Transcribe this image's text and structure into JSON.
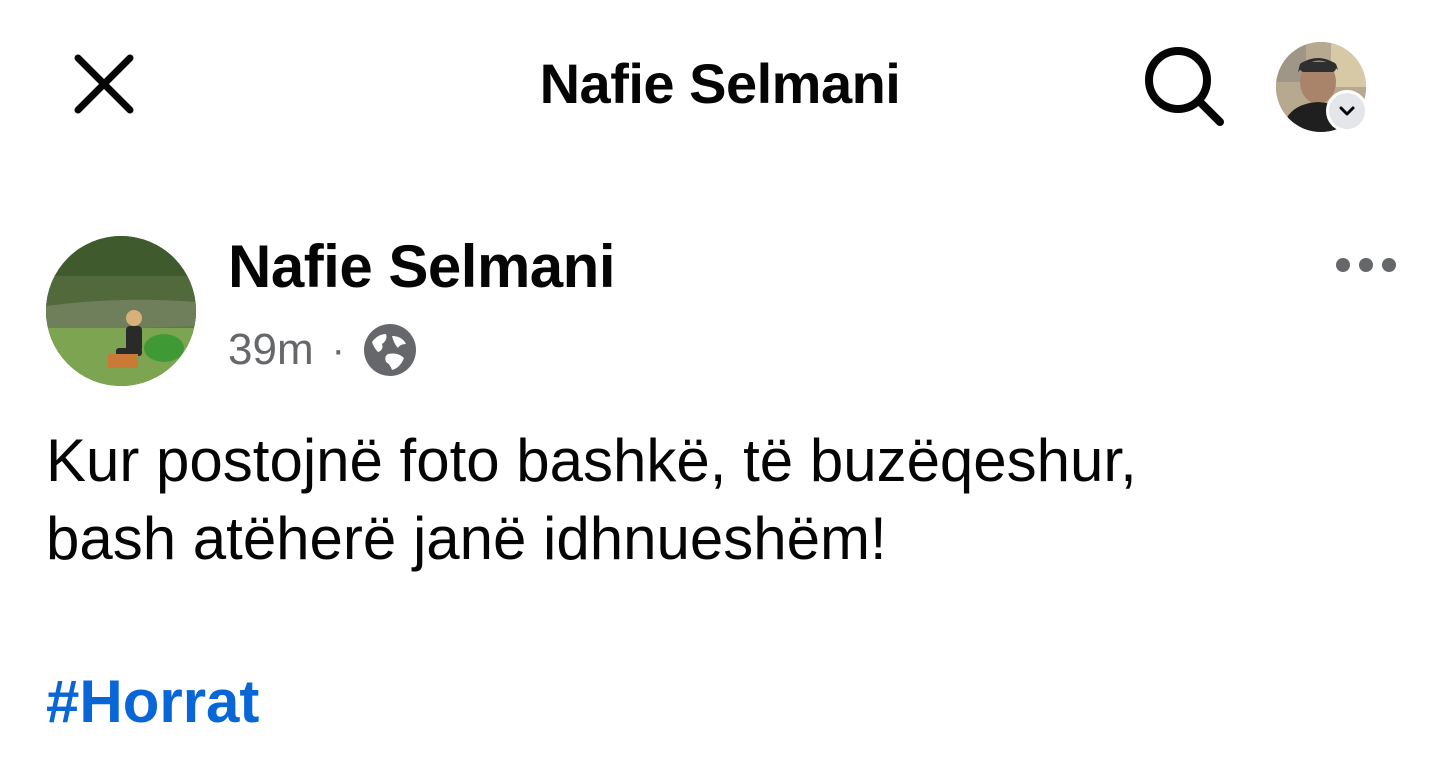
{
  "header": {
    "title": "Nafie Selmani",
    "close_icon": "close-icon",
    "search_icon": "search-icon",
    "account_caret_icon": "chevron-down-icon"
  },
  "post": {
    "author": "Nafie Selmani",
    "time": "39m",
    "separator": "·",
    "audience_icon": "globe-icon",
    "more_icon": "more-horizontal-icon",
    "text_lines": [
      "Kur postojnë foto bashkë, të buzëqeshur,",
      "bash atëherë janë idhnueshëm!"
    ],
    "hashtag": "#Horrat"
  },
  "colors": {
    "text": "#050505",
    "secondary_text": "#65676b",
    "link": "#0866d6",
    "background": "#ffffff"
  }
}
